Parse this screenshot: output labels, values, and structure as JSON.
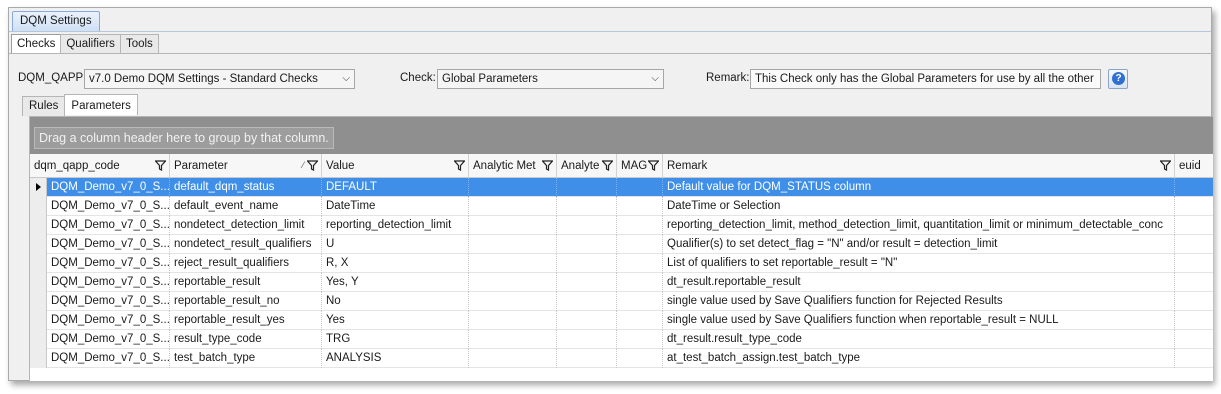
{
  "window": {
    "doc_tab": "DQM Settings"
  },
  "sub_tabs": [
    "Checks",
    "Qualifiers",
    "Tools"
  ],
  "form": {
    "dqm_qapp_label": "DQM_QAPP:",
    "dqm_qapp_value": "v7.0 Demo DQM Settings - Standard Checks",
    "check_label": "Check:",
    "check_value": "Global Parameters",
    "remark_label": "Remark:",
    "remark_value": "This Check only has the Global Parameters for use by all the other"
  },
  "inner_tabs": [
    "Rules",
    "Parameters"
  ],
  "grid": {
    "group_hint": "Drag a column header here to group by that column.",
    "columns": [
      "dqm_qapp_code",
      "Parameter",
      "Value",
      "Analytic Met",
      "Analyte",
      "MAG",
      "Remark",
      "euid"
    ],
    "rows": [
      [
        "DQM_Demo_v7_0_S...",
        "default_dqm_status",
        "DEFAULT",
        "",
        "",
        "",
        "Default value for DQM_STATUS column",
        ""
      ],
      [
        "DQM_Demo_v7_0_S...",
        "default_event_name",
        "DateTime",
        "",
        "",
        "",
        "DateTime or Selection",
        ""
      ],
      [
        "DQM_Demo_v7_0_S...",
        "nondetect_detection_limit",
        "reporting_detection_limit",
        "",
        "",
        "",
        "reporting_detection_limit, method_detection_limit, quantitation_limit or minimum_detectable_conc",
        ""
      ],
      [
        "DQM_Demo_v7_0_S...",
        "nondetect_result_qualifiers",
        "U",
        "",
        "",
        "",
        "Qualifier(s) to set detect_flag = \"N\" and/or result = detection_limit",
        ""
      ],
      [
        "DQM_Demo_v7_0_S...",
        "reject_result_qualifiers",
        "R, X",
        "",
        "",
        "",
        "List of qualifiers to set reportable_result = \"N\"",
        ""
      ],
      [
        "DQM_Demo_v7_0_S...",
        "reportable_result",
        "Yes, Y",
        "",
        "",
        "",
        "dt_result.reportable_result",
        ""
      ],
      [
        "DQM_Demo_v7_0_S...",
        "reportable_result_no",
        "No",
        "",
        "",
        "",
        "single value used by Save Qualifiers function for Rejected Results",
        ""
      ],
      [
        "DQM_Demo_v7_0_S...",
        "reportable_result_yes",
        "Yes",
        "",
        "",
        "",
        "single value used by Save Qualifiers function when reportable_result = NULL",
        ""
      ],
      [
        "DQM_Demo_v7_0_S...",
        "result_type_code",
        "TRG",
        "",
        "",
        "",
        "dt_result.result_type_code",
        ""
      ],
      [
        "DQM_Demo_v7_0_S...",
        "test_batch_type",
        "ANALYSIS",
        "",
        "",
        "",
        "at_test_batch_assign.test_batch_type",
        ""
      ]
    ]
  }
}
